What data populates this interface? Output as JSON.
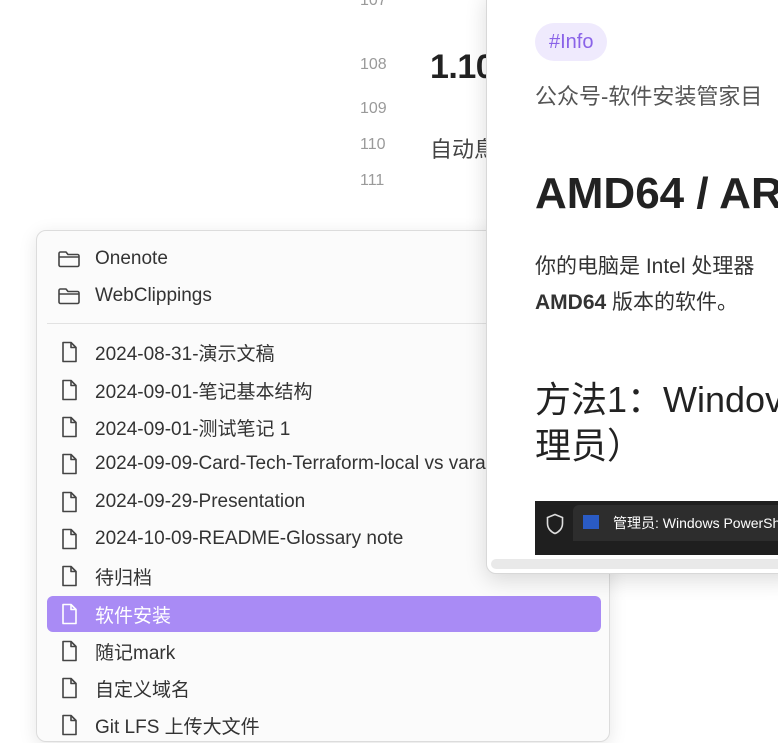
{
  "editor": {
    "line_numbers": [
      "107",
      "108",
      "109",
      "110",
      "111"
    ],
    "heading_partial": "1.10",
    "text_partial": "自动鳥"
  },
  "switcher": {
    "folders": [
      {
        "label": "Onenote",
        "icon": "folder-icon"
      },
      {
        "label": "WebClippings",
        "icon": "folder-icon"
      }
    ],
    "files": [
      {
        "label": "2024-08-31-演示文稿",
        "icon": "file-icon"
      },
      {
        "label": "2024-09-01-笔记基本结构",
        "icon": "file-icon"
      },
      {
        "label": "2024-09-01-测试笔记 1",
        "icon": "file-icon"
      },
      {
        "label": "2024-09-09-Card-Tech-Terraform-local vs vara",
        "icon": "file-icon"
      },
      {
        "label": "2024-09-29-Presentation",
        "icon": "file-icon"
      },
      {
        "label": "2024-10-09-README-Glossary note",
        "icon": "file-icon"
      },
      {
        "label": "待归档",
        "icon": "file-icon"
      },
      {
        "label": "软件安装",
        "icon": "file-icon",
        "selected": true
      },
      {
        "label": "随记mark",
        "icon": "file-icon"
      },
      {
        "label": "自定义域名",
        "icon": "file-icon"
      },
      {
        "label": "Git LFS 上传大文件",
        "icon": "file-icon"
      }
    ],
    "accent": "#a98bf5"
  },
  "preview": {
    "tag": "#Info",
    "line1": "公众号-软件安装管家目",
    "h1": "AMD64 / AR",
    "para_line1": "你的电脑是 Intel 处理器",
    "para_line2_bold": "AMD64",
    "para_line2_rest": " 版本的软件。",
    "h2_line1": "方法1：Windov",
    "h2_line2": "理员）",
    "image_title": "管理员: Windows PowerSh",
    "tag_color": "#8a63e8"
  }
}
